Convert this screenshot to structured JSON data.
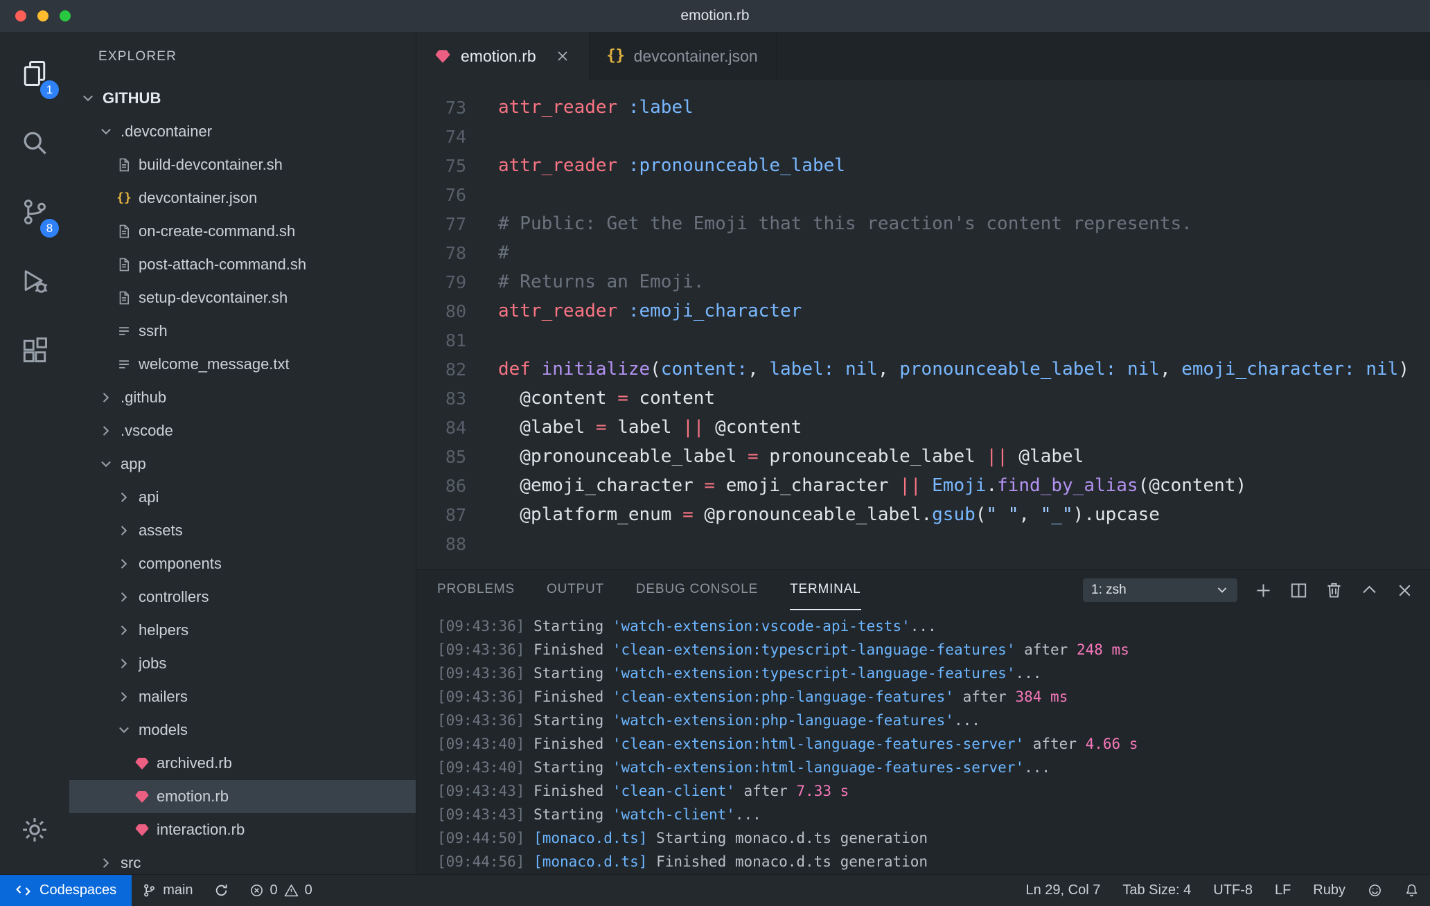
{
  "window": {
    "title": "emotion.rb"
  },
  "icons": {
    "braces": "{}"
  },
  "activity_bar": {
    "explorer_badge": "1",
    "scm_badge": "8"
  },
  "sidebar": {
    "header": "EXPLORER",
    "tree": [
      {
        "label": "GITHUB",
        "indent": 0,
        "icon": "chevron-down",
        "root": true
      },
      {
        "label": ".devcontainer",
        "indent": 1,
        "icon": "chevron-down"
      },
      {
        "label": "build-devcontainer.sh",
        "indent": 2,
        "icon": "file"
      },
      {
        "label": "devcontainer.json",
        "indent": 2,
        "icon": "braces"
      },
      {
        "label": "on-create-command.sh",
        "indent": 2,
        "icon": "file"
      },
      {
        "label": "post-attach-command.sh",
        "indent": 2,
        "icon": "file"
      },
      {
        "label": "setup-devcontainer.sh",
        "indent": 2,
        "icon": "file"
      },
      {
        "label": "ssrh",
        "indent": 2,
        "icon": "lines"
      },
      {
        "label": "welcome_message.txt",
        "indent": 2,
        "icon": "lines"
      },
      {
        "label": ".github",
        "indent": 1,
        "icon": "chevron-right"
      },
      {
        "label": ".vscode",
        "indent": 1,
        "icon": "chevron-right"
      },
      {
        "label": "app",
        "indent": 1,
        "icon": "chevron-down"
      },
      {
        "label": "api",
        "indent": 2,
        "icon": "chevron-right"
      },
      {
        "label": "assets",
        "indent": 2,
        "icon": "chevron-right"
      },
      {
        "label": "components",
        "indent": 2,
        "icon": "chevron-right"
      },
      {
        "label": "controllers",
        "indent": 2,
        "icon": "chevron-right"
      },
      {
        "label": "helpers",
        "indent": 2,
        "icon": "chevron-right"
      },
      {
        "label": "jobs",
        "indent": 2,
        "icon": "chevron-right"
      },
      {
        "label": "mailers",
        "indent": 2,
        "icon": "chevron-right"
      },
      {
        "label": "models",
        "indent": 2,
        "icon": "chevron-down"
      },
      {
        "label": "archived.rb",
        "indent": 3,
        "icon": "ruby"
      },
      {
        "label": "emotion.rb",
        "indent": 3,
        "icon": "ruby",
        "selected": true
      },
      {
        "label": "interaction.rb",
        "indent": 3,
        "icon": "ruby"
      },
      {
        "label": "src",
        "indent": 1,
        "icon": "chevron-right"
      }
    ]
  },
  "tabs": [
    {
      "label": "emotion.rb",
      "icon": "ruby",
      "active": true
    },
    {
      "label": "devcontainer.json",
      "icon": "braces",
      "active": false
    }
  ],
  "editor": {
    "lines": [
      {
        "num": "73",
        "tokens": [
          [
            "kw",
            "attr_reader"
          ],
          [
            "pl",
            " "
          ],
          [
            "sym",
            ":label"
          ]
        ]
      },
      {
        "num": "74",
        "tokens": []
      },
      {
        "num": "75",
        "tokens": [
          [
            "kw",
            "attr_reader"
          ],
          [
            "pl",
            " "
          ],
          [
            "sym",
            ":pronounceable_label"
          ]
        ]
      },
      {
        "num": "76",
        "tokens": []
      },
      {
        "num": "77",
        "tokens": [
          [
            "com",
            "# Public: Get the Emoji that this reaction's content represents."
          ]
        ]
      },
      {
        "num": "78",
        "tokens": [
          [
            "com",
            "#"
          ]
        ]
      },
      {
        "num": "79",
        "tokens": [
          [
            "com",
            "# Returns an Emoji."
          ]
        ]
      },
      {
        "num": "80",
        "tokens": [
          [
            "kw",
            "attr_reader"
          ],
          [
            "pl",
            " "
          ],
          [
            "sym",
            ":emoji_character"
          ]
        ]
      },
      {
        "num": "81",
        "tokens": []
      },
      {
        "num": "82",
        "tokens": [
          [
            "kw",
            "def"
          ],
          [
            "pl",
            " "
          ],
          [
            "fn",
            "initialize"
          ],
          [
            "pl",
            "("
          ],
          [
            "sym",
            "content:"
          ],
          [
            "pl",
            ", "
          ],
          [
            "sym",
            "label:"
          ],
          [
            "pl",
            " "
          ],
          [
            "sym",
            "nil"
          ],
          [
            "pl",
            ", "
          ],
          [
            "sym",
            "pronounceable_label:"
          ],
          [
            "pl",
            " "
          ],
          [
            "sym",
            "nil"
          ],
          [
            "pl",
            ", "
          ],
          [
            "sym",
            "emoji_character:"
          ],
          [
            "pl",
            " "
          ],
          [
            "sym",
            "nil"
          ],
          [
            "pl",
            ")"
          ]
        ]
      },
      {
        "num": "83",
        "tokens": [
          [
            "pl",
            "  @content "
          ],
          [
            "kw",
            "="
          ],
          [
            "pl",
            " content"
          ]
        ]
      },
      {
        "num": "84",
        "tokens": [
          [
            "pl",
            "  @label "
          ],
          [
            "kw",
            "="
          ],
          [
            "pl",
            " label "
          ],
          [
            "kw",
            "||"
          ],
          [
            "pl",
            " @content"
          ]
        ]
      },
      {
        "num": "85",
        "tokens": [
          [
            "pl",
            "  @pronounceable_label "
          ],
          [
            "kw",
            "="
          ],
          [
            "pl",
            " pronounceable_label "
          ],
          [
            "kw",
            "||"
          ],
          [
            "pl",
            " @label"
          ]
        ]
      },
      {
        "num": "86",
        "tokens": [
          [
            "pl",
            "  @emoji_character "
          ],
          [
            "kw",
            "="
          ],
          [
            "pl",
            " emoji_character "
          ],
          [
            "kw",
            "||"
          ],
          [
            "pl",
            " "
          ],
          [
            "sym",
            "Emoji"
          ],
          [
            "pl",
            "."
          ],
          [
            "fn",
            "find_by_alias"
          ],
          [
            "pl",
            "(@content)"
          ]
        ]
      },
      {
        "num": "87",
        "tokens": [
          [
            "pl",
            "  @platform_enum "
          ],
          [
            "kw",
            "="
          ],
          [
            "pl",
            " @pronounceable_label."
          ],
          [
            "sym",
            "gsub"
          ],
          [
            "pl",
            "("
          ],
          [
            "str",
            "\" \""
          ],
          [
            "pl",
            ", "
          ],
          [
            "str",
            "\"_\""
          ],
          [
            "pl",
            ").upcase"
          ]
        ]
      },
      {
        "num": "88",
        "tokens": []
      }
    ]
  },
  "panel": {
    "tabs": [
      {
        "label": "PROBLEMS",
        "active": false
      },
      {
        "label": "OUTPUT",
        "active": false
      },
      {
        "label": "DEBUG CONSOLE",
        "active": false
      },
      {
        "label": "TERMINAL",
        "active": true
      }
    ],
    "shell_selector": "1: zsh",
    "terminal": [
      {
        "tokens": [
          [
            "time",
            "[09:43:36]"
          ],
          [
            "txt",
            " Starting "
          ],
          [
            "task",
            "'watch-extension:vscode-api-tests'"
          ],
          [
            "txt",
            "..."
          ]
        ]
      },
      {
        "tokens": [
          [
            "time",
            "[09:43:36]"
          ],
          [
            "txt",
            " Finished "
          ],
          [
            "task",
            "'clean-extension:typescript-language-features'"
          ],
          [
            "txt",
            " after "
          ],
          [
            "dur",
            "248 ms"
          ]
        ]
      },
      {
        "tokens": [
          [
            "time",
            "[09:43:36]"
          ],
          [
            "txt",
            " Starting "
          ],
          [
            "task",
            "'watch-extension:typescript-language-features'"
          ],
          [
            "txt",
            "..."
          ]
        ]
      },
      {
        "tokens": [
          [
            "time",
            "[09:43:36]"
          ],
          [
            "txt",
            " Finished "
          ],
          [
            "task",
            "'clean-extension:php-language-features'"
          ],
          [
            "txt",
            " after "
          ],
          [
            "dur",
            "384 ms"
          ]
        ]
      },
      {
        "tokens": [
          [
            "time",
            "[09:43:36]"
          ],
          [
            "txt",
            " Starting "
          ],
          [
            "task",
            "'watch-extension:php-language-features'"
          ],
          [
            "txt",
            "..."
          ]
        ]
      },
      {
        "tokens": [
          [
            "time",
            "[09:43:40]"
          ],
          [
            "txt",
            " Finished "
          ],
          [
            "task",
            "'clean-extension:html-language-features-server'"
          ],
          [
            "txt",
            " after "
          ],
          [
            "dur",
            "4.66 s"
          ]
        ]
      },
      {
        "tokens": [
          [
            "time",
            "[09:43:40]"
          ],
          [
            "txt",
            " Starting "
          ],
          [
            "task",
            "'watch-extension:html-language-features-server'"
          ],
          [
            "txt",
            "..."
          ]
        ]
      },
      {
        "tokens": [
          [
            "time",
            "[09:43:43]"
          ],
          [
            "txt",
            " Finished "
          ],
          [
            "task",
            "'clean-client'"
          ],
          [
            "txt",
            " after "
          ],
          [
            "dur",
            "7.33 s"
          ]
        ]
      },
      {
        "tokens": [
          [
            "time",
            "[09:43:43]"
          ],
          [
            "txt",
            " Starting "
          ],
          [
            "task",
            "'watch-client'"
          ],
          [
            "txt",
            "..."
          ]
        ]
      },
      {
        "tokens": [
          [
            "time",
            "[09:44:50]"
          ],
          [
            "txt",
            " "
          ],
          [
            "task",
            "[monaco.d.ts]"
          ],
          [
            "txt",
            " Starting monaco.d.ts generation"
          ]
        ]
      },
      {
        "tokens": [
          [
            "time",
            "[09:44:56]"
          ],
          [
            "txt",
            " "
          ],
          [
            "task",
            "[monaco.d.ts]"
          ],
          [
            "txt",
            " Finished monaco.d.ts generation"
          ]
        ]
      }
    ]
  },
  "status_bar": {
    "remote": "Codespaces",
    "branch": "main",
    "errors": "0",
    "warnings": "0",
    "right": [
      {
        "label": "Ln 29, Col 7"
      },
      {
        "label": "Tab Size: 4"
      },
      {
        "label": "UTF-8"
      },
      {
        "label": "LF"
      },
      {
        "label": "Ruby"
      }
    ]
  },
  "colors": {
    "accent_blue": "#0969da",
    "badge_blue": "#2f81f7",
    "ruby_pink": "#ec5f82",
    "braces_gold": "#e3b341",
    "keyword_red": "#f97583",
    "symbol_blue": "#79b8ff",
    "function_purple": "#b392f0",
    "string_blue": "#9ecbff",
    "comment_gray": "#6a737d",
    "code_text": "#e1e4e8",
    "task_blue": "#6cb6ff",
    "duration_pink": "#f778ba",
    "timestamp_gray": "#6e7681",
    "terminal_text": "#b8c0c8",
    "bg_editor": "#24292e",
    "bg_dark": "#1f2428",
    "bg_panel": "#21262b",
    "bg_titlebar": "#2f363e",
    "bg_selected": "#39414a",
    "border_dark": "#1b1f23",
    "traffic_red": "#ff5f57",
    "traffic_yellow": "#febc2e",
    "traffic_green": "#28c840"
  }
}
